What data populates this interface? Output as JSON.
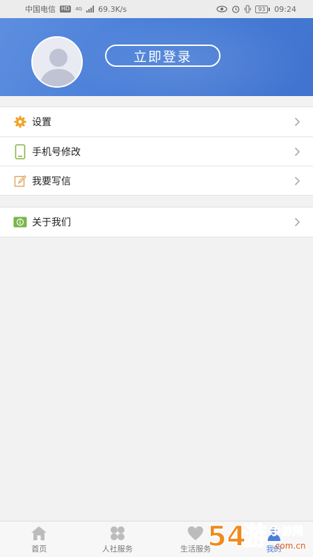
{
  "status_bar": {
    "carrier": "中国电信",
    "hd": "HD",
    "network": "4G",
    "speed": "69.3K/s",
    "battery": "93",
    "time": "09:24"
  },
  "header": {
    "login_label": "立即登录",
    "avatar_icon": "default-avatar-icon"
  },
  "menu": {
    "group1": [
      {
        "label": "设置",
        "icon": "gear-icon"
      },
      {
        "label": "手机号修改",
        "icon": "phone-icon"
      },
      {
        "label": "我要写信",
        "icon": "edit-icon"
      }
    ],
    "group2": [
      {
        "label": "关于我们",
        "icon": "info-icon"
      }
    ]
  },
  "tabbar": [
    {
      "label": "首页",
      "icon": "home-icon"
    },
    {
      "label": "人社服务",
      "icon": "clover-icon"
    },
    {
      "label": "生活服务",
      "icon": "heart-icon"
    },
    {
      "label": "我的",
      "icon": "person-icon"
    }
  ],
  "watermark": {
    "text": "54游手游网",
    "domain": ".com.cn"
  },
  "colors": {
    "header_blue": "#4a7fd8",
    "gear_orange": "#f0a22a",
    "icon_green": "#7ab648",
    "edit_orange": "#e2a25a"
  }
}
